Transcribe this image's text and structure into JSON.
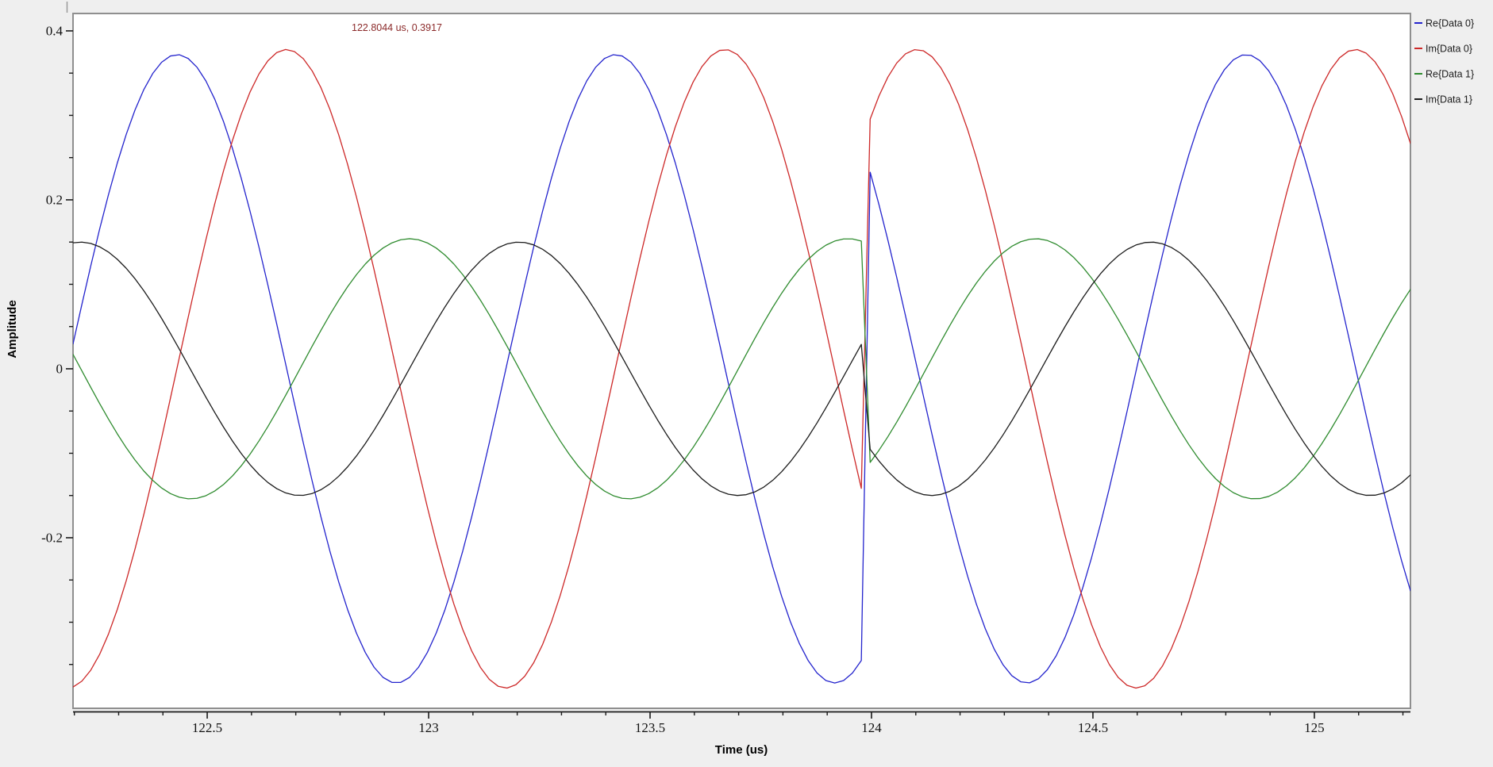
{
  "chart_data": {
    "type": "line",
    "xlabel": "Time (us)",
    "ylabel": "Amplitude",
    "grid": "off",
    "legend_position": "top-right-outside",
    "annotation": {
      "text": "122.8044 us, 0.3917",
      "t_us": 122.8044,
      "value": 0.3917,
      "color": "#8b2a2a"
    },
    "x_axis": {
      "range_us": [
        122.197,
        125.217
      ],
      "major_ticks": [
        122.5,
        123.0,
        123.5,
        124.0,
        124.5,
        125.0
      ],
      "major_labels": [
        "122.5",
        "123",
        "123.5",
        "124",
        "124.5",
        "125"
      ],
      "minor_step": 0.1
    },
    "y_axis": {
      "range": [
        -0.4019,
        0.4206
      ],
      "major_ticks": [
        0.4,
        0.2,
        0.0,
        -0.2
      ],
      "major_labels": [
        "0.4",
        "0.2",
        "0",
        "-0.2"
      ],
      "minor_step": 0.05,
      "minor_min": -0.35,
      "minor_max": 0.4
    },
    "sampling": {
      "t_start_us": 122.197,
      "t_end_us": 125.217,
      "step_us": 0.02,
      "discontinuity_t_us": 123.99,
      "note": "All four traces are sinusoids v(t)=amplitude*cos(2*pi*(t-peak_t)/period); at the discontinuity every trace jumps to the phase given by peak_t_after."
    },
    "series": [
      {
        "name": "Re{Data 0}",
        "color": "#2323cd",
        "amplitude": 0.372,
        "period_us": 0.99,
        "peak_t_before": 122.432,
        "peak_t_after": 123.856
      },
      {
        "name": "Im{Data 0}",
        "color": "#cd2828",
        "amplitude": 0.378,
        "period_us": 0.99,
        "peak_t_before": 122.679,
        "peak_t_after": 124.103
      },
      {
        "name": "Re{Data 1}",
        "color": "#2e8b2e",
        "amplitude": 0.154,
        "period_us": 0.99,
        "peak_t_before": 122.957,
        "peak_t_after": 124.371
      },
      {
        "name": "Im{Data 1}",
        "color": "#1b1b1b",
        "amplitude": 0.15,
        "period_us": 0.99,
        "peak_t_before": 123.204,
        "peak_t_after": 124.631
      }
    ],
    "colors": {
      "background": "#efefef",
      "canvas": "#ffffff",
      "canvas_frame": "#8f8f8f",
      "axis_line": "#1a1a1a"
    }
  },
  "legend": {
    "items": [
      {
        "label": "Re{Data 0}",
        "color": "#2323cd"
      },
      {
        "label": "Im{Data 0}",
        "color": "#cd2828"
      },
      {
        "label": "Re{Data 1}",
        "color": "#2e8b2e"
      },
      {
        "label": "Im{Data 1}",
        "color": "#1b1b1b"
      }
    ]
  }
}
